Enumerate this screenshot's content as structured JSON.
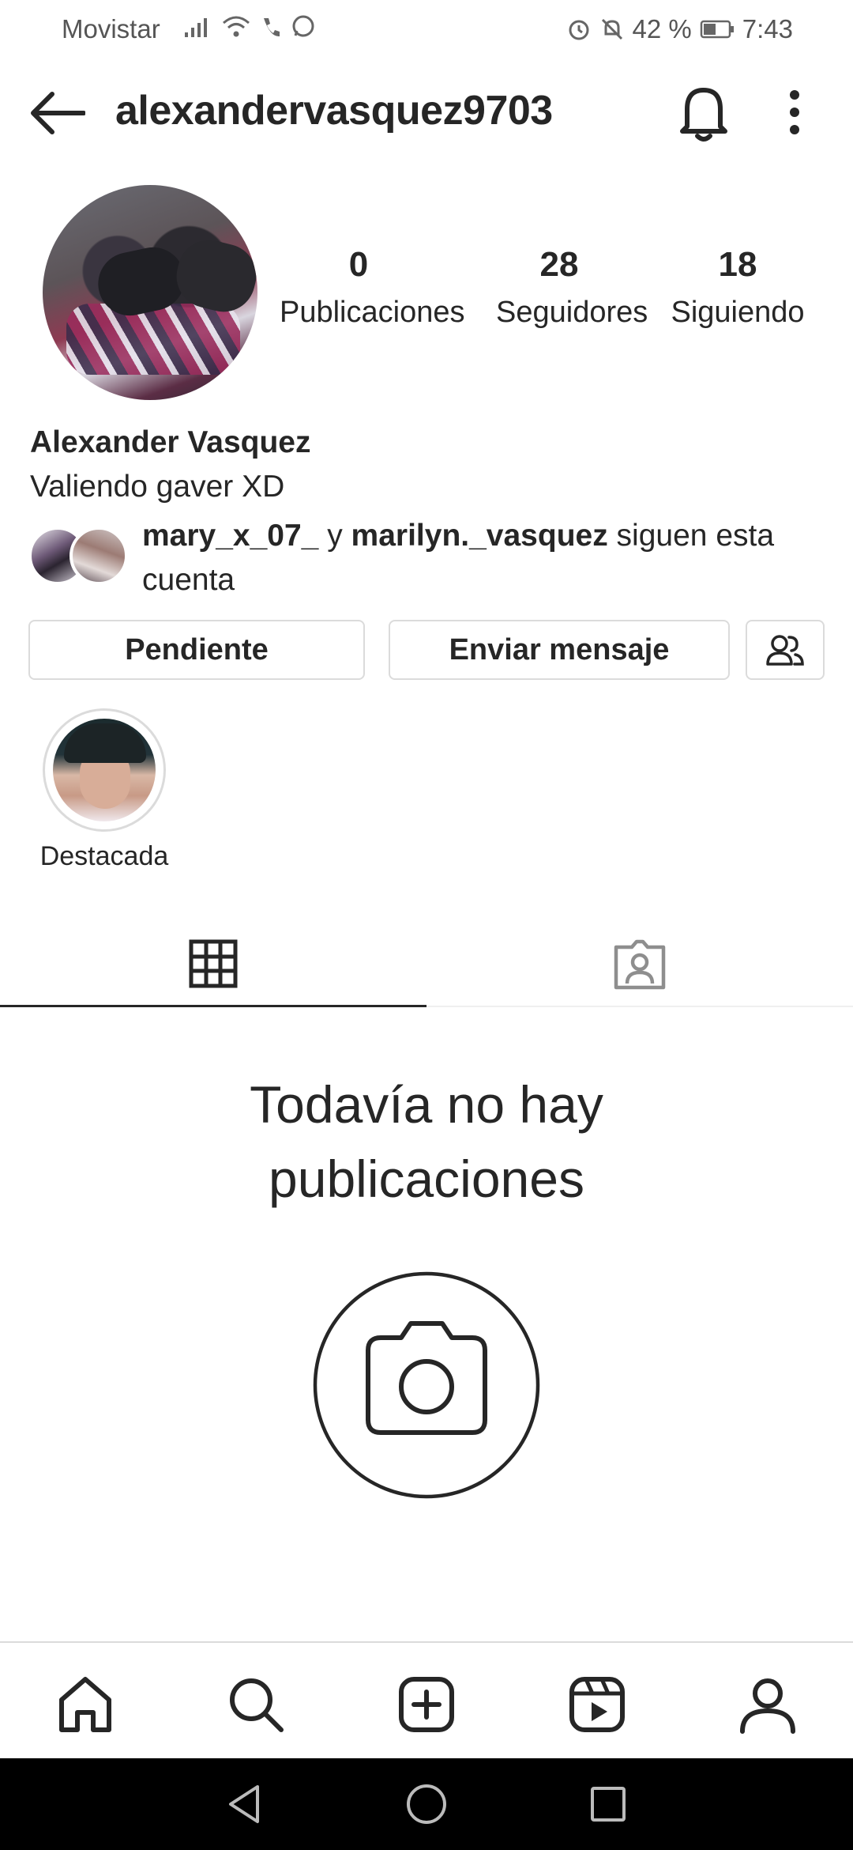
{
  "status_bar": {
    "carrier": "Movistar",
    "battery": "42 %",
    "time": "7:43"
  },
  "header": {
    "username": "alexandervasquez9703"
  },
  "profile": {
    "stats": {
      "posts_count": "0",
      "posts_label": "Publicaciones",
      "followers_count": "28",
      "followers_label": "Seguidores",
      "following_count": "18",
      "following_label": "Siguiendo"
    },
    "full_name": "Alexander Vasquez",
    "bio": "Valiendo gaver XD",
    "followed_by": {
      "user1": "mary_x_07_",
      "connector": " y ",
      "user2": "marilyn._vasquez",
      "suffix": " siguen esta cuenta"
    }
  },
  "actions": {
    "pending_label": "Pendiente",
    "message_label": "Enviar mensaje"
  },
  "highlights": [
    {
      "label": "Destacada"
    }
  ],
  "empty_state": {
    "line1": "Todavía no hay",
    "line2": "publicaciones"
  },
  "icons": {
    "back": "arrow-left-icon",
    "notifications": "bell-icon",
    "more": "more-vertical-icon",
    "suggest": "add-people-icon",
    "grid_tab": "grid-icon",
    "tagged_tab": "tagged-person-icon",
    "camera": "camera-icon",
    "home": "home-icon",
    "search": "search-icon",
    "create": "plus-square-icon",
    "reels": "reels-icon",
    "profile": "profile-icon"
  }
}
